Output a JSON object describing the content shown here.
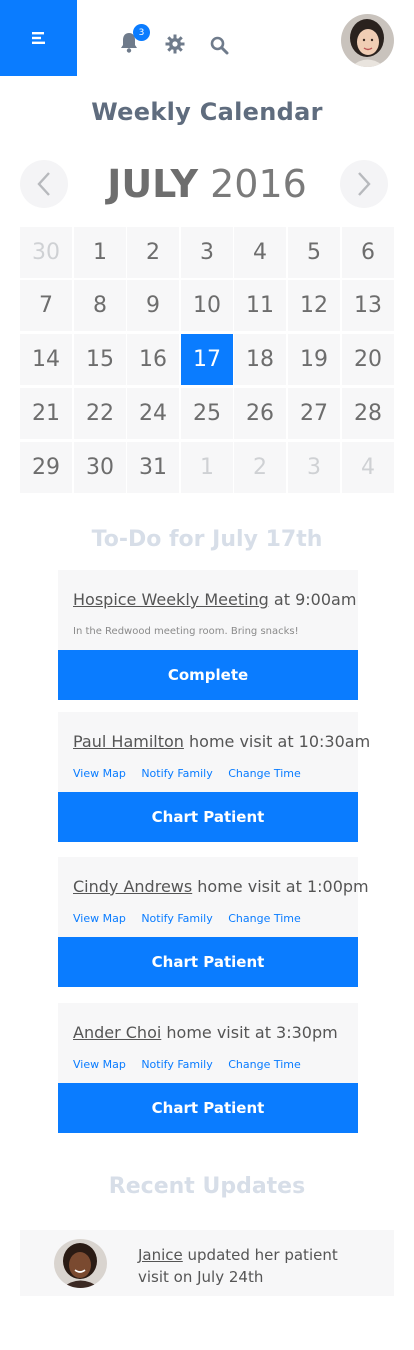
{
  "header": {
    "notification_count": "3",
    "accent_color": "#0a7cff",
    "icons": [
      "menu-icon",
      "bell-icon",
      "gear-icon",
      "search-icon",
      "user-avatar"
    ]
  },
  "page": {
    "title": "Weekly Calendar"
  },
  "calendar": {
    "month": "JULY",
    "year": "2016",
    "weeks": [
      [
        "30",
        "1",
        "2",
        "3",
        "4",
        "5",
        "6"
      ],
      [
        "7",
        "8",
        "9",
        "10",
        "11",
        "12",
        "13"
      ],
      [
        "14",
        "15",
        "16",
        "17",
        "18",
        "19",
        "20"
      ],
      [
        "21",
        "22",
        "24",
        "25",
        "26",
        "27",
        "28"
      ],
      [
        "29",
        "30",
        "31",
        "1",
        "2",
        "3",
        "4"
      ]
    ],
    "selected_day": "17"
  },
  "todo": {
    "heading": "To-Do for July 17th",
    "items": [
      {
        "name": "Hospice Weekly Meeting",
        "rest": " at 9:00am",
        "note": "In the Redwood meeting room. Bring snacks!",
        "action": "Complete"
      },
      {
        "name": "Paul Hamilton",
        "rest": " home visit at 10:30am",
        "links": [
          "View Map",
          "Notify Family",
          "Change Time"
        ],
        "action": "Chart Patient"
      },
      {
        "name": "Cindy Andrews",
        "rest": " home visit at 1:00pm",
        "links": [
          "View Map",
          "Notify Family",
          "Change Time"
        ],
        "action": "Chart Patient"
      },
      {
        "name": "Ander Choi",
        "rest": " home visit at 3:30pm",
        "links": [
          "View Map",
          "Notify Family",
          "Change Time"
        ],
        "action": "Chart Patient"
      }
    ]
  },
  "updates": {
    "heading": "Recent Updates",
    "items": [
      {
        "who": "Janice",
        "text": " updated her patient visit on July 24th"
      }
    ]
  }
}
